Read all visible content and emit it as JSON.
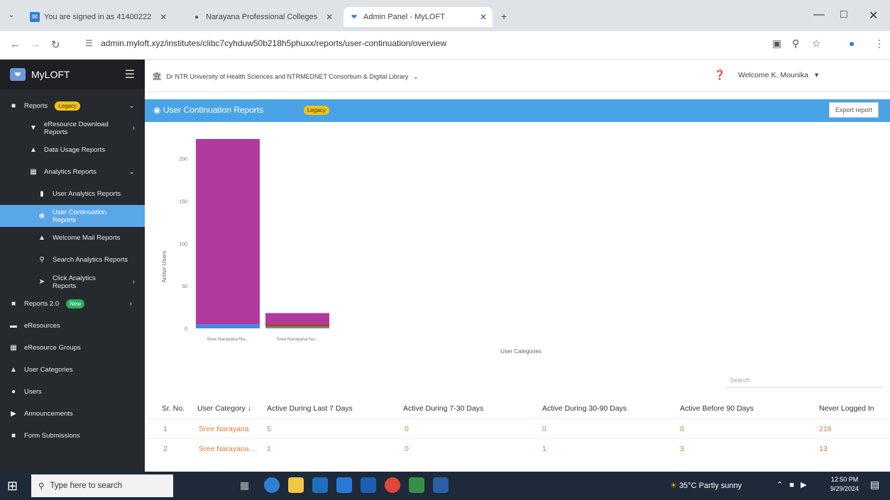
{
  "browser": {
    "tabs": [
      {
        "title": "You are signed in as 41400222",
        "icon": "mail-icon"
      },
      {
        "title": "Narayana Professional Colleges",
        "icon": "globe-icon"
      },
      {
        "title": "Admin Panel - MyLOFT",
        "icon": "myloft-icon"
      }
    ],
    "url": "admin.myloft.xyz/institutes/clibc7cyhduw50b218h5phuxx/reports/user-continuation/overview"
  },
  "sidebar": {
    "brand": "MyLOFT",
    "items": [
      {
        "label": "Reports",
        "badge": "Legacy",
        "icon": "chart-icon",
        "level": 0
      },
      {
        "label": "eResource Download Reports",
        "icon": "download-icon",
        "level": 1
      },
      {
        "label": "Data Usage Reports",
        "icon": "person-icon",
        "level": 1
      },
      {
        "label": "Analytics Reports",
        "icon": "analytics-icon",
        "level": 1
      },
      {
        "label": "User Analytics Reports",
        "icon": "file-icon",
        "level": 2
      },
      {
        "label": "User Continuation Reports",
        "icon": "circle-icon",
        "level": 2
      },
      {
        "label": "Welcome Mail Reports",
        "icon": "person-icon",
        "level": 2
      },
      {
        "label": "Search Analytics Reports",
        "icon": "search-icon",
        "level": 2
      },
      {
        "label": "Click Analytics Reports",
        "icon": "pointer-icon",
        "level": 2
      },
      {
        "label": "Reports 2.0",
        "badge": "New",
        "icon": "chart-icon",
        "level": 0
      },
      {
        "label": "eResources",
        "icon": "book-icon",
        "level": 0
      },
      {
        "label": "eResource Groups",
        "icon": "grid-icon",
        "level": 0
      },
      {
        "label": "User Categories",
        "icon": "users-icon",
        "level": 0
      },
      {
        "label": "Users",
        "icon": "user-icon",
        "level": 0
      },
      {
        "label": "Announcements",
        "icon": "megaphone-icon",
        "level": 0
      },
      {
        "label": "Form Submissions",
        "icon": "form-icon",
        "level": 0
      }
    ]
  },
  "header": {
    "institution": "Dr NTR University of Health Sciences and NTRMEDNET Consortium & Digital Library",
    "welcome": "Welcome K. Mounika"
  },
  "page": {
    "title": "User Continuation Reports",
    "badge": "Legacy",
    "export_label": "Export report",
    "search_placeholder": "Search"
  },
  "chart_data": {
    "type": "bar",
    "stacked": true,
    "categories": [
      "Sree Narayana Nu...",
      "Sree Narayana Nu..."
    ],
    "series": [
      {
        "name": "Active During Last 7 Days",
        "values": [
          5,
          1
        ],
        "color": "#4a86e8"
      },
      {
        "name": "Active During 7-30 Days",
        "values": [
          0,
          0
        ],
        "color": "#e67e22"
      },
      {
        "name": "Active During 30-90 Days",
        "values": [
          0,
          1
        ],
        "color": "#27ae60"
      },
      {
        "name": "Active Before 90 Days",
        "values": [
          0,
          3
        ],
        "color": "#c0392b"
      },
      {
        "name": "Never Logged In",
        "values": [
          218,
          13
        ],
        "color": "#b03a9e"
      }
    ],
    "xlabel": "User Categories",
    "ylabel": "Active Users",
    "yticks": [
      0,
      50,
      100,
      150,
      200
    ],
    "ylim": [
      0,
      223
    ]
  },
  "table": {
    "headers": [
      "Sr. No.",
      "User Category ↓",
      "Active During Last 7 Days",
      "Active During 7-30 Days",
      "Active During 30-90 Days",
      "Active Before 90 Days",
      "Never Logged In"
    ],
    "rows": [
      [
        "1",
        "Sree Narayana",
        "5",
        "0",
        "0",
        "0",
        "218"
      ],
      [
        "2",
        "Sree Narayana ...",
        "1",
        "0",
        "1",
        "3",
        "13"
      ]
    ]
  },
  "taskbar": {
    "search_placeholder": "Type here to search",
    "weather": "35°C  Partly sunny",
    "time": "12:50 PM",
    "date": "9/29/2024"
  }
}
